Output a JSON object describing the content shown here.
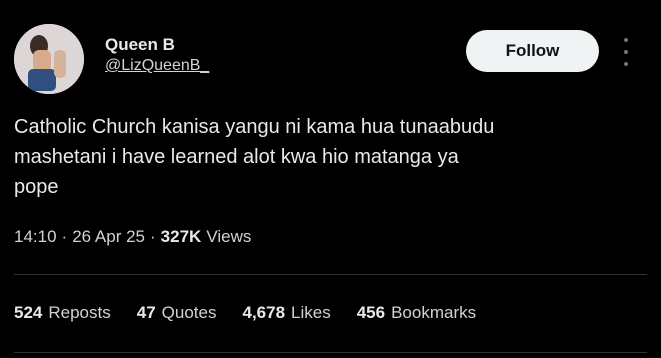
{
  "user": {
    "name": "Queen B",
    "handle": "@LizQueenB_",
    "follow_label": "Follow"
  },
  "tweet": {
    "text": "Catholic Church kanisa yangu ni kama hua tunaabudu\nmashetani i have learned alot kwa hio matanga ya\npope"
  },
  "meta": {
    "time": "14:10",
    "separator": "·",
    "date": "26 Apr 25",
    "views_count": "327K",
    "views_label": "Views"
  },
  "stats": [
    {
      "count": "524",
      "label": "Reposts"
    },
    {
      "count": "47",
      "label": "Quotes"
    },
    {
      "count": "4,678",
      "label": "Likes"
    },
    {
      "count": "456",
      "label": "Bookmarks"
    }
  ]
}
